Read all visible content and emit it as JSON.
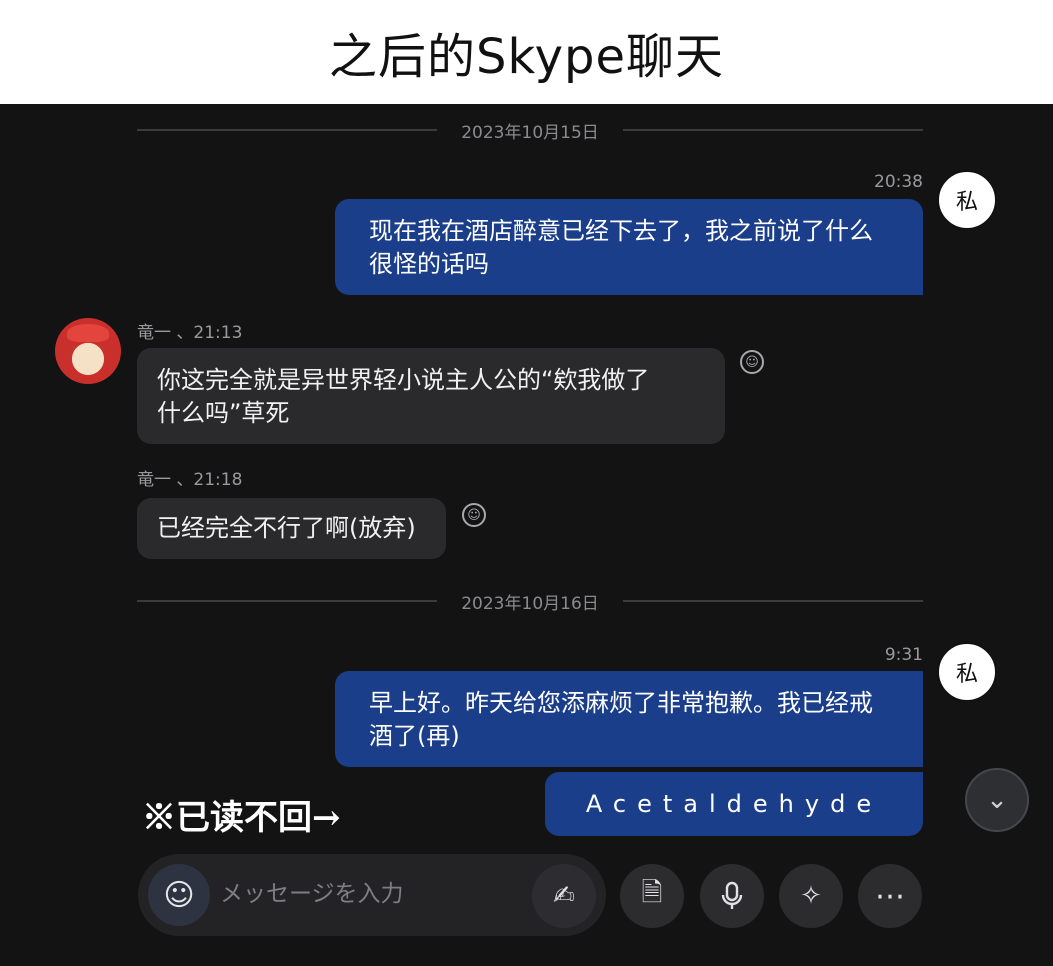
{
  "page_title": "之后的Skype聊天",
  "chat": {
    "dates": [
      "2023年10月15日",
      "2023年10月16日"
    ],
    "messages": [
      {
        "sender": "me",
        "avatar_label": "私",
        "time": "20:38",
        "lines": [
          "现在我在酒店醉意已经下去了，我之前说了什么",
          "很怪的话吗"
        ]
      },
      {
        "sender": "other",
        "header": "竜一 、21:13",
        "lines": [
          "你这完全就是异世界轻小说主人公的“欸我做了",
          "什么吗”草死"
        ]
      },
      {
        "sender": "other",
        "header": "竜一 、21:18",
        "lines": [
          "已经完全不行了啊(放弃)"
        ]
      },
      {
        "sender": "me",
        "avatar_label": "私",
        "time": "9:31",
        "lines": [
          "早上好。昨天给您添麻烦了非常抱歉。我已经戒",
          "酒了(再)"
        ]
      },
      {
        "sender": "me",
        "lines": [
          "Acetaldehyde"
        ]
      }
    ]
  },
  "annotation": "※已读不回→",
  "composer": {
    "placeholder": "メッセージを入力",
    "icons": [
      "smiley-icon",
      "handwriting-icon",
      "file-icon",
      "microphone-icon",
      "sparkle-icon",
      "more-icon"
    ]
  },
  "colors": {
    "bg": "#131314",
    "me_bubble": "#1a3e8a",
    "other_bubble": "#2a2a2c"
  }
}
